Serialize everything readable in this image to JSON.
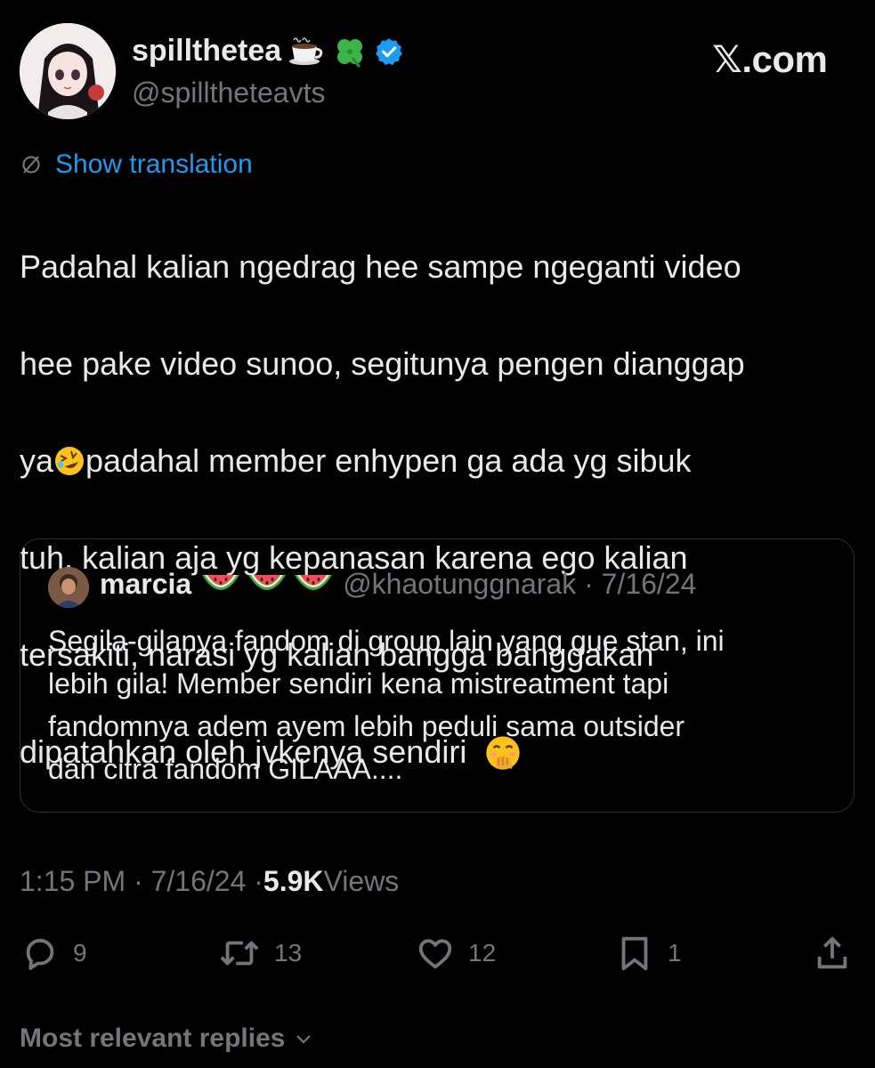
{
  "header": {
    "display_name": "spillthetea",
    "handle": "@spilltheteavts",
    "brand": "𝕏.com",
    "verified": true
  },
  "translation": {
    "label": "Show translation"
  },
  "tweet": {
    "lines": [
      "Padahal kalian ngedrag hee  sampe ngeganti video",
      "hee pake video sunoo, segitunya pengen dianggap",
      "padahal member enhypen ga ada yg sibuk",
      "tuh, kalian aja yg kepanasan karena ego kalian",
      "tersakiti, narasi yg kalian bangga banggakan",
      "dipatahkan oleh jvkenya sendiri"
    ],
    "line3_prefix": "ya"
  },
  "quote": {
    "name": "marcia",
    "handle_date": "@khaotunggnarak · 7/16/24",
    "lines": [
      "Segila-gilanya fandom di group lain yang gue stan, ini",
      "lebih gila! Member sendiri kena mistreatment tapi",
      "fandomnya adem ayem lebih peduli sama outsider",
      "dan citra fandom GILAAA...."
    ]
  },
  "meta": {
    "time_date": "1:15 PM · 7/16/24 · ",
    "views_count": "5.9K",
    "views_label": " Views"
  },
  "actions": {
    "replies": "9",
    "reposts": "13",
    "likes": "12",
    "bookmarks": "1"
  },
  "replies_sort": {
    "label": "Most relevant replies"
  },
  "colors": {
    "background": "#000000",
    "text": "#e7e9ea",
    "muted": "#71767b",
    "link": "#1d9bf0",
    "verified": "#1d9bf0",
    "border": "#2f3336"
  }
}
